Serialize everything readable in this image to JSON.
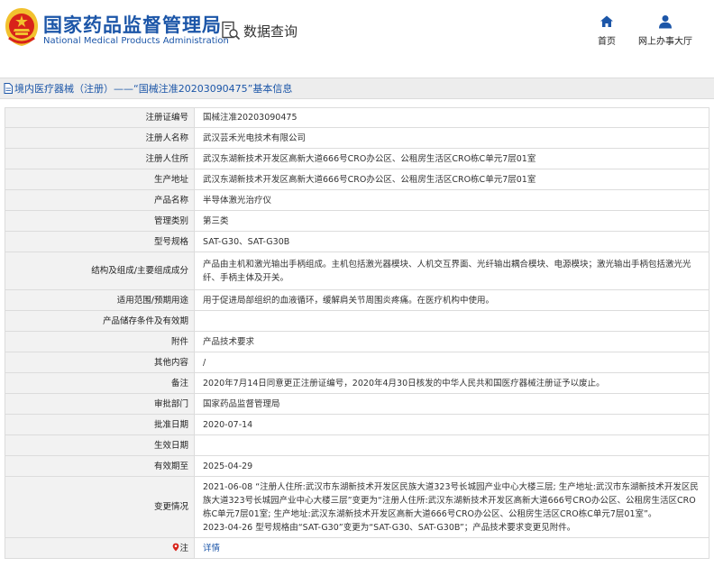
{
  "header": {
    "brand_cn": "国家药品监督管理局",
    "brand_en": "National Medical Products Administration",
    "query_label": "数据查询",
    "nav": [
      {
        "label": "首页",
        "icon": "home-icon"
      },
      {
        "label": "网上办事大厅",
        "icon": "user-icon"
      }
    ]
  },
  "breadcrumb": {
    "text": "境内医疗器械（注册）——“国械注准20203090475”基本信息"
  },
  "rows": {
    "reg_no": {
      "label": "注册证编号",
      "value": "国械注准20203090475"
    },
    "registrant": {
      "label": "注册人名称",
      "value": "武汉芸禾光电技术有限公司"
    },
    "residence": {
      "label": "注册人住所",
      "value": "武汉东湖新技术开发区高新大道666号CRO办公区、公租房生活区CRO栋C单元7层01室"
    },
    "mfg_address": {
      "label": "生产地址",
      "value": "武汉东湖新技术开发区高新大道666号CRO办公区、公租房生活区CRO栋C单元7层01室"
    },
    "product_name": {
      "label": "产品名称",
      "value": "半导体激光治疗仪"
    },
    "category": {
      "label": "管理类别",
      "value": "第三类"
    },
    "model": {
      "label": "型号规格",
      "value": "SAT-G30、SAT-G30B"
    },
    "structure": {
      "label": "结构及组成/主要组成成分",
      "value": "产品由主机和激光输出手柄组成。主机包括激光器模块、人机交互界面、光纤输出耦合模块、电源模块；激光输出手柄包括激光光纤、手柄主体及开关。"
    },
    "scope": {
      "label": "适用范围/预期用途",
      "value": "用于促进局部组织的血液循环，缓解肩关节周围炎疼痛。在医疗机构中使用。"
    },
    "storage": {
      "label": "产品储存条件及有效期",
      "value": ""
    },
    "attachment": {
      "label": "附件",
      "value": "产品技术要求"
    },
    "other": {
      "label": "其他内容",
      "value": "/"
    },
    "remark": {
      "label": "备注",
      "value": "2020年7月14日同意更正注册证编号，2020年4月30日核发的中华人民共和国医疗器械注册证予以废止。"
    },
    "approval_dept": {
      "label": "审批部门",
      "value": "国家药品监督管理局"
    },
    "approval_date": {
      "label": "批准日期",
      "value": "2020-07-14"
    },
    "effective_date": {
      "label": "生效日期",
      "value": ""
    },
    "valid_until": {
      "label": "有效期至",
      "value": "2025-04-29"
    },
    "changes": {
      "label": "变更情况",
      "line1": "2021-06-08 “注册人住所:武汉市东湖新技术开发区民族大道323号长城园产业中心大楼三层; 生产地址:武汉市东湖新技术开发区民族大道323号长城园产业中心大楼三层”变更为“注册人住所:武汉东湖新技术开发区高新大道666号CRO办公区、公租房生活区CRO栋C单元7层01室; 生产地址:武汉东湖新技术开发区高新大道666号CRO办公区、公租房生活区CRO栋C单元7层01室”。",
      "line2": "2023-04-26 型号规格由“SAT-G30”变更为“SAT-G30、SAT-G30B”；产品技术要求变更见附件。"
    },
    "note": {
      "label": "注",
      "value": "详情",
      "icon": "location-pin-icon"
    }
  },
  "colors": {
    "brand": "#1c56a8",
    "label_bg": "#f2f2f2",
    "border": "#dcdcdc",
    "emblem_red": "#d8231a",
    "emblem_gold": "#f2c12e"
  }
}
